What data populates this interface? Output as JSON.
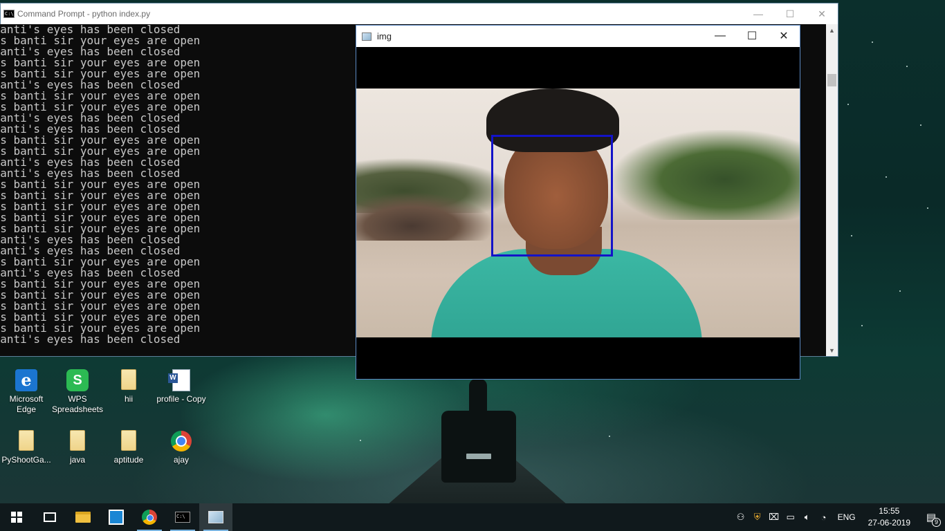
{
  "cmd_window": {
    "title": "Command Prompt - python  index.py",
    "lines": [
      " banti's eyes has been closed",
      "yes banti sir your eyes are open",
      " banti's eyes has been closed",
      "yes banti sir your eyes are open",
      "yes banti sir your eyes are open",
      " banti's eyes has been closed",
      "yes banti sir your eyes are open",
      "yes banti sir your eyes are open",
      " banti's eyes has been closed",
      " banti's eyes has been closed",
      "yes banti sir your eyes are open",
      "yes banti sir your eyes are open",
      " banti's eyes has been closed",
      " banti's eyes has been closed",
      "yes banti sir your eyes are open",
      "yes banti sir your eyes are open",
      "yes banti sir your eyes are open",
      "yes banti sir your eyes are open",
      "yes banti sir your eyes are open",
      " banti's eyes has been closed",
      " banti's eyes has been closed",
      "yes banti sir your eyes are open",
      " banti's eyes has been closed",
      "yes banti sir your eyes are open",
      "yes banti sir your eyes are open",
      "yes banti sir your eyes are open",
      "yes banti sir your eyes are open",
      "yes banti sir your eyes are open",
      " banti's eyes has been closed"
    ]
  },
  "img_window": {
    "title": "img",
    "detection_box_color": "#1313c8"
  },
  "window_controls": {
    "minimize": "—",
    "maximize": "☐",
    "close": "✕"
  },
  "desktop_icons": [
    {
      "label": "Microsoft Edge",
      "icon": "edge-icon"
    },
    {
      "label": "WPS Spreadsheets",
      "icon": "wps-spreadsheets-icon"
    },
    {
      "label": "hii",
      "icon": "folder-icon"
    },
    {
      "label": "profile - Copy",
      "icon": "word-document-icon"
    },
    {
      "label": "PyShootGa...",
      "icon": "folder-icon"
    },
    {
      "label": "java",
      "icon": "folder-icon"
    },
    {
      "label": "aptitude",
      "icon": "folder-icon"
    },
    {
      "label": "ajay",
      "icon": "chrome-icon"
    }
  ],
  "taskbar": {
    "pinned": [
      "start-icon",
      "task-view-icon",
      "file-explorer-icon",
      "store-icon",
      "chrome-icon",
      "command-prompt-icon",
      "img-window-icon"
    ],
    "tray": {
      "language": "ENG",
      "time": "15:55",
      "date": "27-06-2019",
      "notification_count": "9"
    }
  }
}
